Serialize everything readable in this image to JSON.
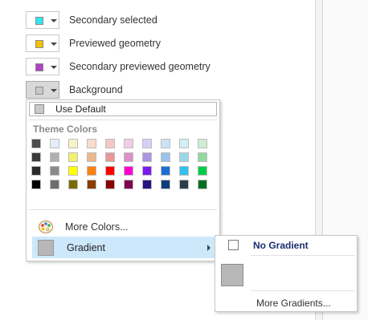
{
  "colors": {
    "secondary_selected": "#33e5f0",
    "previewed_geometry": "#f2c200",
    "secondary_previewed_geometry": "#b044c6",
    "background": "#c9c9c9",
    "highlight": "#cde8fb"
  },
  "settings": [
    {
      "label": "Secondary selected",
      "swatch": "#33e5f0"
    },
    {
      "label": "Previewed geometry",
      "swatch": "#f2c200"
    },
    {
      "label": "Secondary previewed geometry",
      "swatch": "#b044c6"
    },
    {
      "label": "Background",
      "swatch": "#c9c9c9"
    }
  ],
  "dropdown": {
    "use_default_label": "Use Default",
    "theme_colors_title": "Theme Colors",
    "more_colors_label": "More Colors...",
    "gradient_label": "Gradient",
    "theme_colors": [
      [
        "#4d4d4d",
        "#e7ecfb",
        "#f4f4c8",
        "#fbdccb",
        "#f6c7c7",
        "#f2cde9",
        "#d8cff6",
        "#cce3f7",
        "#d2eff7",
        "#cdeed2"
      ],
      [
        "#3b3b3b",
        "#b0b0b0",
        "#f1f170",
        "#ebb78c",
        "#e79999",
        "#dd8fc8",
        "#a996e4",
        "#99c3ea",
        "#9ad7e8",
        "#92d9a0"
      ],
      [
        "#2b2b2b",
        "#8a8a8a",
        "#ffff00",
        "#ff7f0f",
        "#ff0000",
        "#ff00cc",
        "#7a1cf0",
        "#1a6fd6",
        "#33c0ef",
        "#00cc44"
      ],
      [
        "#000000",
        "#6d6d6d",
        "#7a6a00",
        "#8a3d00",
        "#880000",
        "#7f0050",
        "#2a1280",
        "#0f3e7a",
        "#2d3e4b",
        "#007020"
      ]
    ]
  },
  "gradient_menu": {
    "no_gradient_label": "No Gradient",
    "more_gradients_label": "More Gradients...",
    "sample_color": "#b7b7b7"
  }
}
